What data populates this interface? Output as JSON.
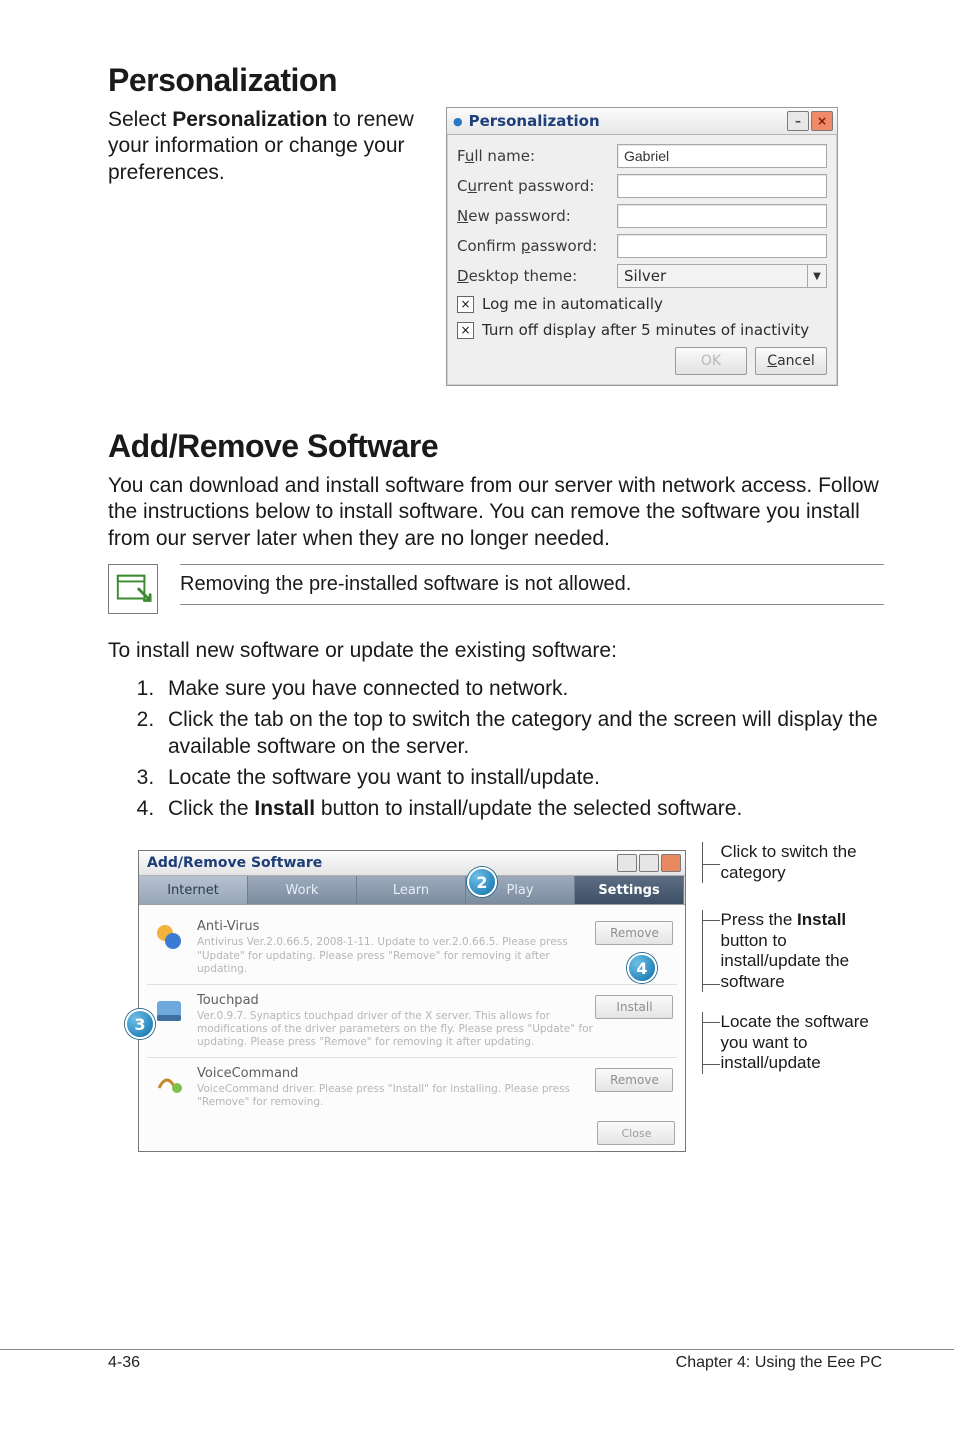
{
  "sections": {
    "personalization_heading": "Personalization",
    "personalization_body_a": "Select ",
    "personalization_body_b": "Personalization",
    "personalization_body_c": " to renew your information or change your preferences.",
    "addremove_heading": "Add/Remove Software",
    "addremove_body": "You can download and install software from our server with network access. Follow the instructions below to install software. You can remove the software you install from our server later when they are no longer needed.",
    "note_text": "Removing the pre-installed software is not allowed.",
    "steps_intro": "To install new software or update the existing software:",
    "steps": [
      "Make sure you have connected to network.",
      "Click the tab on the top to switch the category and the screen will display the available software on the server.",
      "Locate the software you want to install/update.",
      "Click the Install button to install/update the selected software."
    ],
    "step4_prefix": "Click the ",
    "step4_bold": "Install",
    "step4_suffix": " button to install/update the selected software."
  },
  "dlg_personal": {
    "title": "Personalization",
    "labels": {
      "full_name_pre": "F",
      "full_name_u": "u",
      "full_name_post": "ll name:",
      "cur_pw_pre": "C",
      "cur_pw_u": "u",
      "cur_pw_post": "rrent password:",
      "new_pw_u": "N",
      "new_pw_post": "ew password:",
      "conf_pw_pre": "Confirm ",
      "conf_pw_u": "p",
      "conf_pw_post": "assword:",
      "theme_u": "D",
      "theme_post": "esktop theme:"
    },
    "values": {
      "full_name": "Gabriel",
      "desktop_theme": "Silver"
    },
    "checkboxes": {
      "login_auto_pre": "",
      "login_auto_u": "L",
      "login_auto_post": "og me in automatically",
      "turnoff_u": "T",
      "turnoff_post": "urn off display after 5 minutes of inactivity"
    },
    "buttons": {
      "ok": "OK",
      "cancel_u": "C",
      "cancel_post": "ancel"
    }
  },
  "dlg_ar": {
    "title": "Add/Remove Software",
    "tabs": [
      "Internet",
      "Work",
      "Learn",
      "Play",
      "Settings"
    ],
    "active_tab": 4,
    "packages": [
      {
        "name": "Anti-Virus",
        "desc": "Antivirus Ver.2.0.66.5, 2008-1-11. Update to ver.2.0.66.5. Please press \"Update\" for updating. Please press \"Remove\" for removing it after updating.",
        "button": "Remove"
      },
      {
        "name": "Touchpad",
        "desc": "Ver.0.9.7. Synaptics touchpad driver of the X server. This allows for modifications of the driver parameters on the fly. Please press \"Update\" for updating. Please press \"Remove\" for removing it after updating.",
        "button": "Install"
      },
      {
        "name": "VoiceCommand",
        "desc": "VoiceCommand driver. Please press \"Install\" for installing. Please press \"Remove\" for removing.",
        "button": "Remove"
      }
    ],
    "close": "Close"
  },
  "annot": {
    "cat1": "Click to switch the category",
    "install_a": "Press the ",
    "install_b": "Install",
    "install_c": " button to install/update the software",
    "locate": "Locate the software you want to install/update"
  },
  "badges": {
    "b2": "2",
    "b3": "3",
    "b4": "4"
  },
  "footer": {
    "left": "4-36",
    "right": "Chapter 4: Using the Eee PC"
  },
  "icons": {
    "title_dot": "●",
    "minus": "–",
    "x": "×",
    "check": "×",
    "down": "▼"
  }
}
